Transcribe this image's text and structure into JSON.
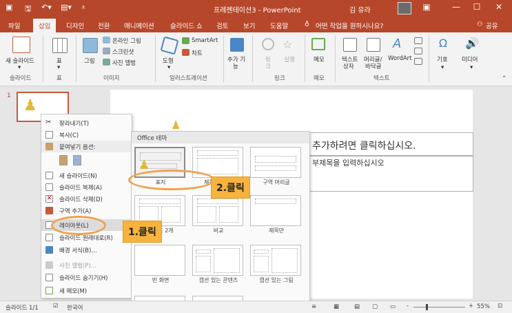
{
  "titlebar": {
    "title": "프레젠테이션3 - PowerPoint",
    "user": "김 유라",
    "qat": [
      "save-icon",
      "undo-icon",
      "customize-icon"
    ]
  },
  "tabs": [
    {
      "label": "파일"
    },
    {
      "label": "삽입"
    },
    {
      "label": "디자인"
    },
    {
      "label": "전환"
    },
    {
      "label": "애니메이션"
    },
    {
      "label": "슬라이드 쇼"
    },
    {
      "label": "검토"
    },
    {
      "label": "보기"
    },
    {
      "label": "도움말"
    }
  ],
  "tell_me": "어떤 작업을 원하시나요?",
  "share": "공유",
  "ribbon": {
    "new_slide": "새 슬라이드",
    "table": "표",
    "picture": "그림",
    "online_picture": "온라인 그림",
    "screenshot": "스크린샷",
    "photo_album": "사진 앨범",
    "shapes": "도형",
    "smartart": "SmartArt",
    "chart": "차트",
    "addins_1": "추가 기",
    "addins_2": "능",
    "link": "링",
    "link2": "크",
    "action": "실행",
    "comment": "메모",
    "textbox_1": "텍스트",
    "textbox_2": "상자",
    "header_1": "머리글/",
    "header_2": "바닥글",
    "wordart": "WordArt",
    "symbols": "기호",
    "media": "미디어",
    "groups": {
      "slides": "슬라이드",
      "tables": "표",
      "images": "이미지",
      "illustrations": "일러스트레이션",
      "links": "링크",
      "comments": "메모",
      "text": "텍스트"
    }
  },
  "slide_number": "1",
  "slide": {
    "title_text": "추가하려면 클릭하십시오.",
    "subtitle_text": "부제목을 입력하십시오"
  },
  "context_menu": [
    {
      "label": "잘라내기(T)",
      "icon": "cut-icon"
    },
    {
      "label": "복사(C)",
      "icon": "copy-icon"
    },
    {
      "label": "붙여넣기 옵션:",
      "icon": "paste-icon"
    },
    {
      "label": "새 슬라이드(N)",
      "icon": "new-slide-icon"
    },
    {
      "label": "슬라이드 복제(A)",
      "icon": "duplicate-slide-icon"
    },
    {
      "label": "슬라이드 삭제(D)",
      "icon": "delete-slide-icon"
    },
    {
      "label": "구역 추가(A)",
      "icon": "add-section-icon"
    },
    {
      "label": "레이아웃(L)",
      "icon": "layout-icon"
    },
    {
      "label": "슬라이드 원래대로(R)",
      "icon": "reset-slide-icon"
    },
    {
      "label": "배경 서식(B)...",
      "icon": "format-background-icon"
    },
    {
      "label": "사진 앨범(P)...",
      "icon": "photo-album-icon"
    },
    {
      "label": "슬라이드 숨기기(H)",
      "icon": "hide-slide-icon"
    },
    {
      "label": "새 메모(M)",
      "icon": "new-comment-icon"
    }
  ],
  "submenu": {
    "header": "Office 테마",
    "layouts": [
      {
        "label": "표지"
      },
      {
        "label": "제목 및 내용"
      },
      {
        "label": "구역 머리글"
      },
      {
        "label": "콘텐츠 2개"
      },
      {
        "label": "비교"
      },
      {
        "label": "제목만"
      },
      {
        "label": "빈 화면"
      },
      {
        "label": "캡션 있는 콘텐츠"
      },
      {
        "label": "캡션 있는 그림"
      }
    ]
  },
  "annotations": {
    "step1": "1.클릭",
    "step2": "2.클릭"
  },
  "statusbar": {
    "slide_info": "슬라이드 1/1",
    "language": "한국어",
    "zoom": "55%",
    "zoom_minus": "-",
    "zoom_plus": "+"
  },
  "colors": {
    "accent": "#b7472a",
    "callout": "#f6b33d"
  }
}
